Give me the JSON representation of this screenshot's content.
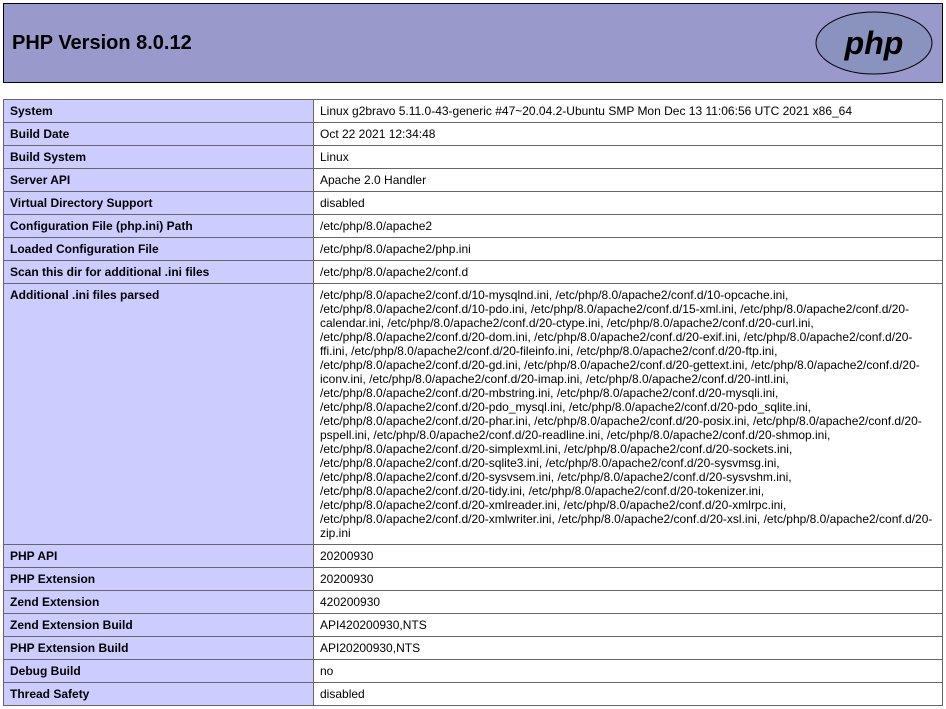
{
  "header": {
    "title": "PHP Version 8.0.12"
  },
  "rows": [
    {
      "label": "System",
      "value": "Linux g2bravo 5.11.0-43-generic #47~20.04.2-Ubuntu SMP Mon Dec 13 11:06:56 UTC 2021 x86_64"
    },
    {
      "label": "Build Date",
      "value": "Oct 22 2021 12:34:48"
    },
    {
      "label": "Build System",
      "value": "Linux"
    },
    {
      "label": "Server API",
      "value": "Apache 2.0 Handler"
    },
    {
      "label": "Virtual Directory Support",
      "value": "disabled"
    },
    {
      "label": "Configuration File (php.ini) Path",
      "value": "/etc/php/8.0/apache2"
    },
    {
      "label": "Loaded Configuration File",
      "value": "/etc/php/8.0/apache2/php.ini"
    },
    {
      "label": "Scan this dir for additional .ini files",
      "value": "/etc/php/8.0/apache2/conf.d"
    },
    {
      "label": "Additional .ini files parsed",
      "value": "/etc/php/8.0/apache2/conf.d/10-mysqlnd.ini, /etc/php/8.0/apache2/conf.d/10-opcache.ini, /etc/php/8.0/apache2/conf.d/10-pdo.ini, /etc/php/8.0/apache2/conf.d/15-xml.ini, /etc/php/8.0/apache2/conf.d/20-calendar.ini, /etc/php/8.0/apache2/conf.d/20-ctype.ini, /etc/php/8.0/apache2/conf.d/20-curl.ini, /etc/php/8.0/apache2/conf.d/20-dom.ini, /etc/php/8.0/apache2/conf.d/20-exif.ini, /etc/php/8.0/apache2/conf.d/20-ffi.ini, /etc/php/8.0/apache2/conf.d/20-fileinfo.ini, /etc/php/8.0/apache2/conf.d/20-ftp.ini, /etc/php/8.0/apache2/conf.d/20-gd.ini, /etc/php/8.0/apache2/conf.d/20-gettext.ini, /etc/php/8.0/apache2/conf.d/20-iconv.ini, /etc/php/8.0/apache2/conf.d/20-imap.ini, /etc/php/8.0/apache2/conf.d/20-intl.ini, /etc/php/8.0/apache2/conf.d/20-mbstring.ini, /etc/php/8.0/apache2/conf.d/20-mysqli.ini, /etc/php/8.0/apache2/conf.d/20-pdo_mysql.ini, /etc/php/8.0/apache2/conf.d/20-pdo_sqlite.ini, /etc/php/8.0/apache2/conf.d/20-phar.ini, /etc/php/8.0/apache2/conf.d/20-posix.ini, /etc/php/8.0/apache2/conf.d/20-pspell.ini, /etc/php/8.0/apache2/conf.d/20-readline.ini, /etc/php/8.0/apache2/conf.d/20-shmop.ini, /etc/php/8.0/apache2/conf.d/20-simplexml.ini, /etc/php/8.0/apache2/conf.d/20-sockets.ini, /etc/php/8.0/apache2/conf.d/20-sqlite3.ini, /etc/php/8.0/apache2/conf.d/20-sysvmsg.ini, /etc/php/8.0/apache2/conf.d/20-sysvsem.ini, /etc/php/8.0/apache2/conf.d/20-sysvshm.ini, /etc/php/8.0/apache2/conf.d/20-tidy.ini, /etc/php/8.0/apache2/conf.d/20-tokenizer.ini, /etc/php/8.0/apache2/conf.d/20-xmlreader.ini, /etc/php/8.0/apache2/conf.d/20-xmlrpc.ini, /etc/php/8.0/apache2/conf.d/20-xmlwriter.ini, /etc/php/8.0/apache2/conf.d/20-xsl.ini, /etc/php/8.0/apache2/conf.d/20-zip.ini"
    },
    {
      "label": "PHP API",
      "value": "20200930"
    },
    {
      "label": "PHP Extension",
      "value": "20200930"
    },
    {
      "label": "Zend Extension",
      "value": "420200930"
    },
    {
      "label": "Zend Extension Build",
      "value": "API420200930,NTS"
    },
    {
      "label": "PHP Extension Build",
      "value": "API20200930,NTS"
    },
    {
      "label": "Debug Build",
      "value": "no"
    },
    {
      "label": "Thread Safety",
      "value": "disabled"
    }
  ]
}
